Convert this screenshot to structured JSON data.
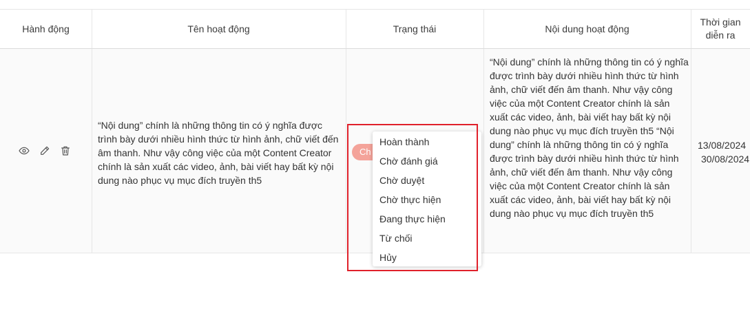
{
  "table": {
    "headers": {
      "actions": "Hành động",
      "name": "Tên hoạt động",
      "status": "Trạng thái",
      "content": "Nội dung hoạt động",
      "time_line1": "Thời gian",
      "time_line2": "diễn ra"
    },
    "row": {
      "name": "“Nội dung” chính là những thông tin có ý nghĩa được trình bày dưới nhiều hình thức từ hình ảnh, chữ viết đến âm thanh. Như vậy công việc của một Content Creator chính là sản xuất các video, ảnh, bài viết hay bất kỳ nội dung nào phục vụ mục đích truyền th5",
      "status_partial": "Ch",
      "content": "“Nội dung” chính là những thông tin có ý nghĩa được trình bày dưới nhiều hình thức từ hình ảnh, chữ viết đến âm thanh. Như vậy công việc của một Content Creator chính là sản xuất các video, ảnh, bài viết hay bất kỳ nội dung nào phục vụ mục đích truyền th5 “Nội dung” chính là những thông tin có ý nghĩa được trình bày dưới nhiều hình thức từ hình ảnh, chữ viết đến âm thanh. Như vậy công việc của một Content Creator chính là sản xuất các video, ảnh, bài viết hay bất kỳ nội dung nào phục vụ mục đích truyền th5",
      "time_start": "13/08/2024",
      "time_end": "30/08/2024",
      "actions": [
        "eye-icon",
        "edit-icon",
        "trash-icon"
      ]
    }
  },
  "status_dropdown": {
    "options": [
      "Hoàn thành",
      "Chờ đánh giá",
      "Chờ duyệt",
      "Chờ thực hiện",
      "Đang thực hiện",
      "Từ chối",
      "Hủy"
    ]
  },
  "colors": {
    "status_pill": "#f4a39a",
    "highlight_border": "#e0202a"
  }
}
